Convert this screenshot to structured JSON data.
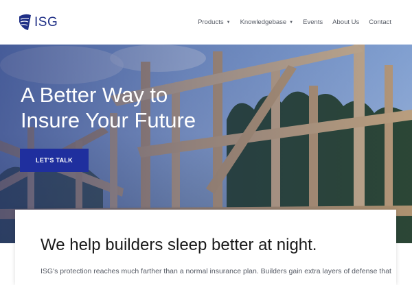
{
  "header": {
    "logo_text": "ISG",
    "nav": [
      {
        "label": "Products",
        "has_dropdown": true
      },
      {
        "label": "Knowledgebase",
        "has_dropdown": true
      },
      {
        "label": "Events",
        "has_dropdown": false
      },
      {
        "label": "About Us",
        "has_dropdown": false
      },
      {
        "label": "Contact",
        "has_dropdown": false
      }
    ]
  },
  "hero": {
    "headline_line1": "A Better Way to",
    "headline_line2": "Insure Your Future",
    "cta_label": "LET'S TALK",
    "image_subject": "wooden house framing against blue sky and trees"
  },
  "content": {
    "title": "We help builders sleep better at night.",
    "body": "ISG's protection reaches much farther than a normal insurance plan. Builders gain extra layers of defense that"
  },
  "colors": {
    "brand": "#1f2f86",
    "cta": "#1f2f9e",
    "nav_text": "#555a64"
  },
  "icons": {
    "logo": "isg-logo-icon",
    "caret": "caret-down-icon"
  }
}
